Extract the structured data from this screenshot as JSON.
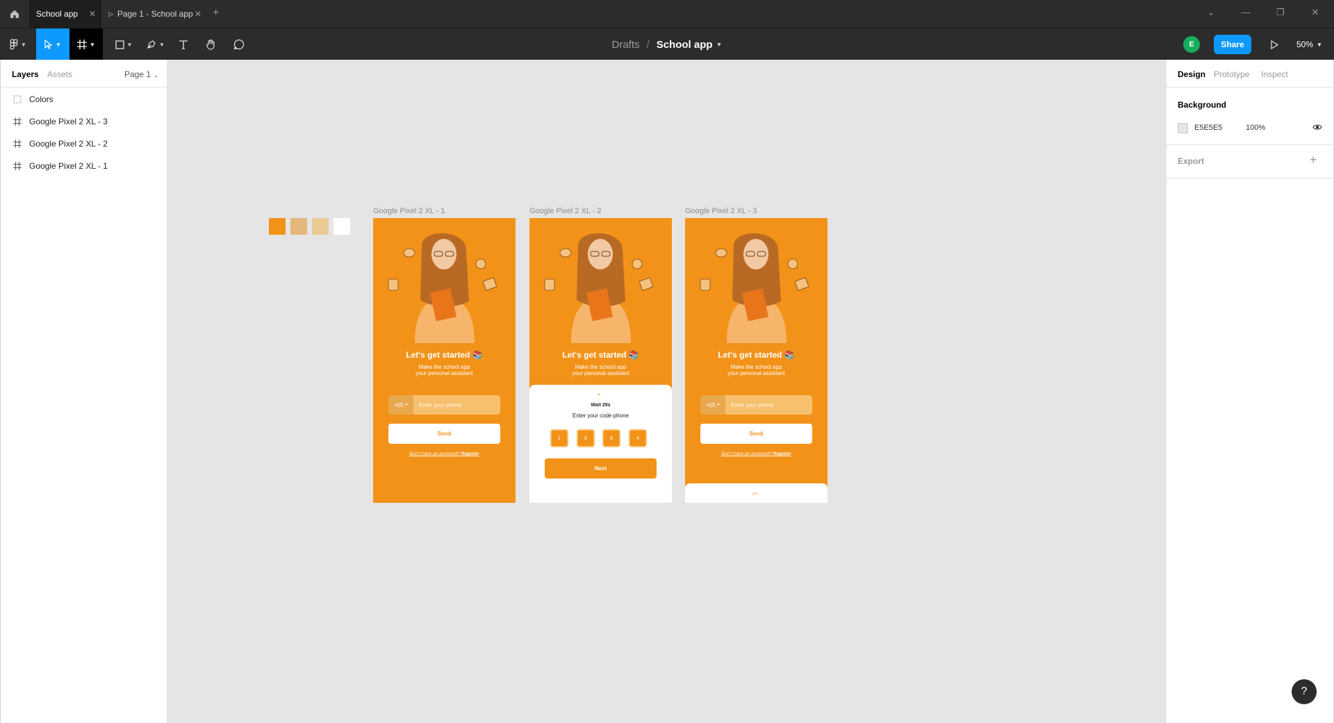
{
  "tabs": {
    "active": "School app",
    "page_tab": "Page 1 - School app",
    "close": "✕",
    "add": "+"
  },
  "toolbar": {
    "breadcrumb_folder": "Drafts",
    "breadcrumb_sep": "/",
    "file_name": "School app",
    "avatar_initial": "E",
    "share_label": "Share",
    "zoom": "50%"
  },
  "left_panel": {
    "tab_layers": "Layers",
    "tab_assets": "Assets",
    "page_select": "Page 1",
    "layers": [
      {
        "name": "Colors",
        "icon": "group-icon"
      },
      {
        "name": "Google Pixel 2 XL - 3",
        "icon": "frame-icon"
      },
      {
        "name": "Google Pixel 2 XL - 2",
        "icon": "frame-icon"
      },
      {
        "name": "Google Pixel 2 XL - 1",
        "icon": "frame-icon"
      }
    ]
  },
  "canvas": {
    "swatches": [
      "#f39218",
      "#e3b87a",
      "#ebcb94",
      "#ffffff"
    ],
    "frames": [
      {
        "label": "Google Pixel 2 XL - 1"
      },
      {
        "label": "Google Pixel 2 XL - 2"
      },
      {
        "label": "Google Pixel 2 XL - 3"
      }
    ],
    "phone": {
      "title": "Let's get started",
      "subtitle_line1": "Make the school app",
      "subtitle_line2": "your personal assistant",
      "country_code": "+55",
      "phone_placeholder": "Enter your phone",
      "send_label": "Send",
      "register_question": "Don´t have an accoount?",
      "register_link": "Register"
    },
    "code_sheet": {
      "wait": "Wait 29s",
      "prompt": "Enter your code phone",
      "digits": [
        "1",
        "6",
        "9",
        "4"
      ],
      "next_label": "Next"
    }
  },
  "right_panel": {
    "tab_design": "Design",
    "tab_prototype": "Prototype",
    "tab_inspect": "Inspect",
    "background_title": "Background",
    "background_hex": "E5E5E5",
    "background_opacity": "100%",
    "export_title": "Export",
    "export_add": "+",
    "help": "?"
  },
  "colors": {
    "accent_blue": "#0d99ff",
    "brand_orange": "#f39218",
    "canvas_bg": "#e5e5e5"
  }
}
